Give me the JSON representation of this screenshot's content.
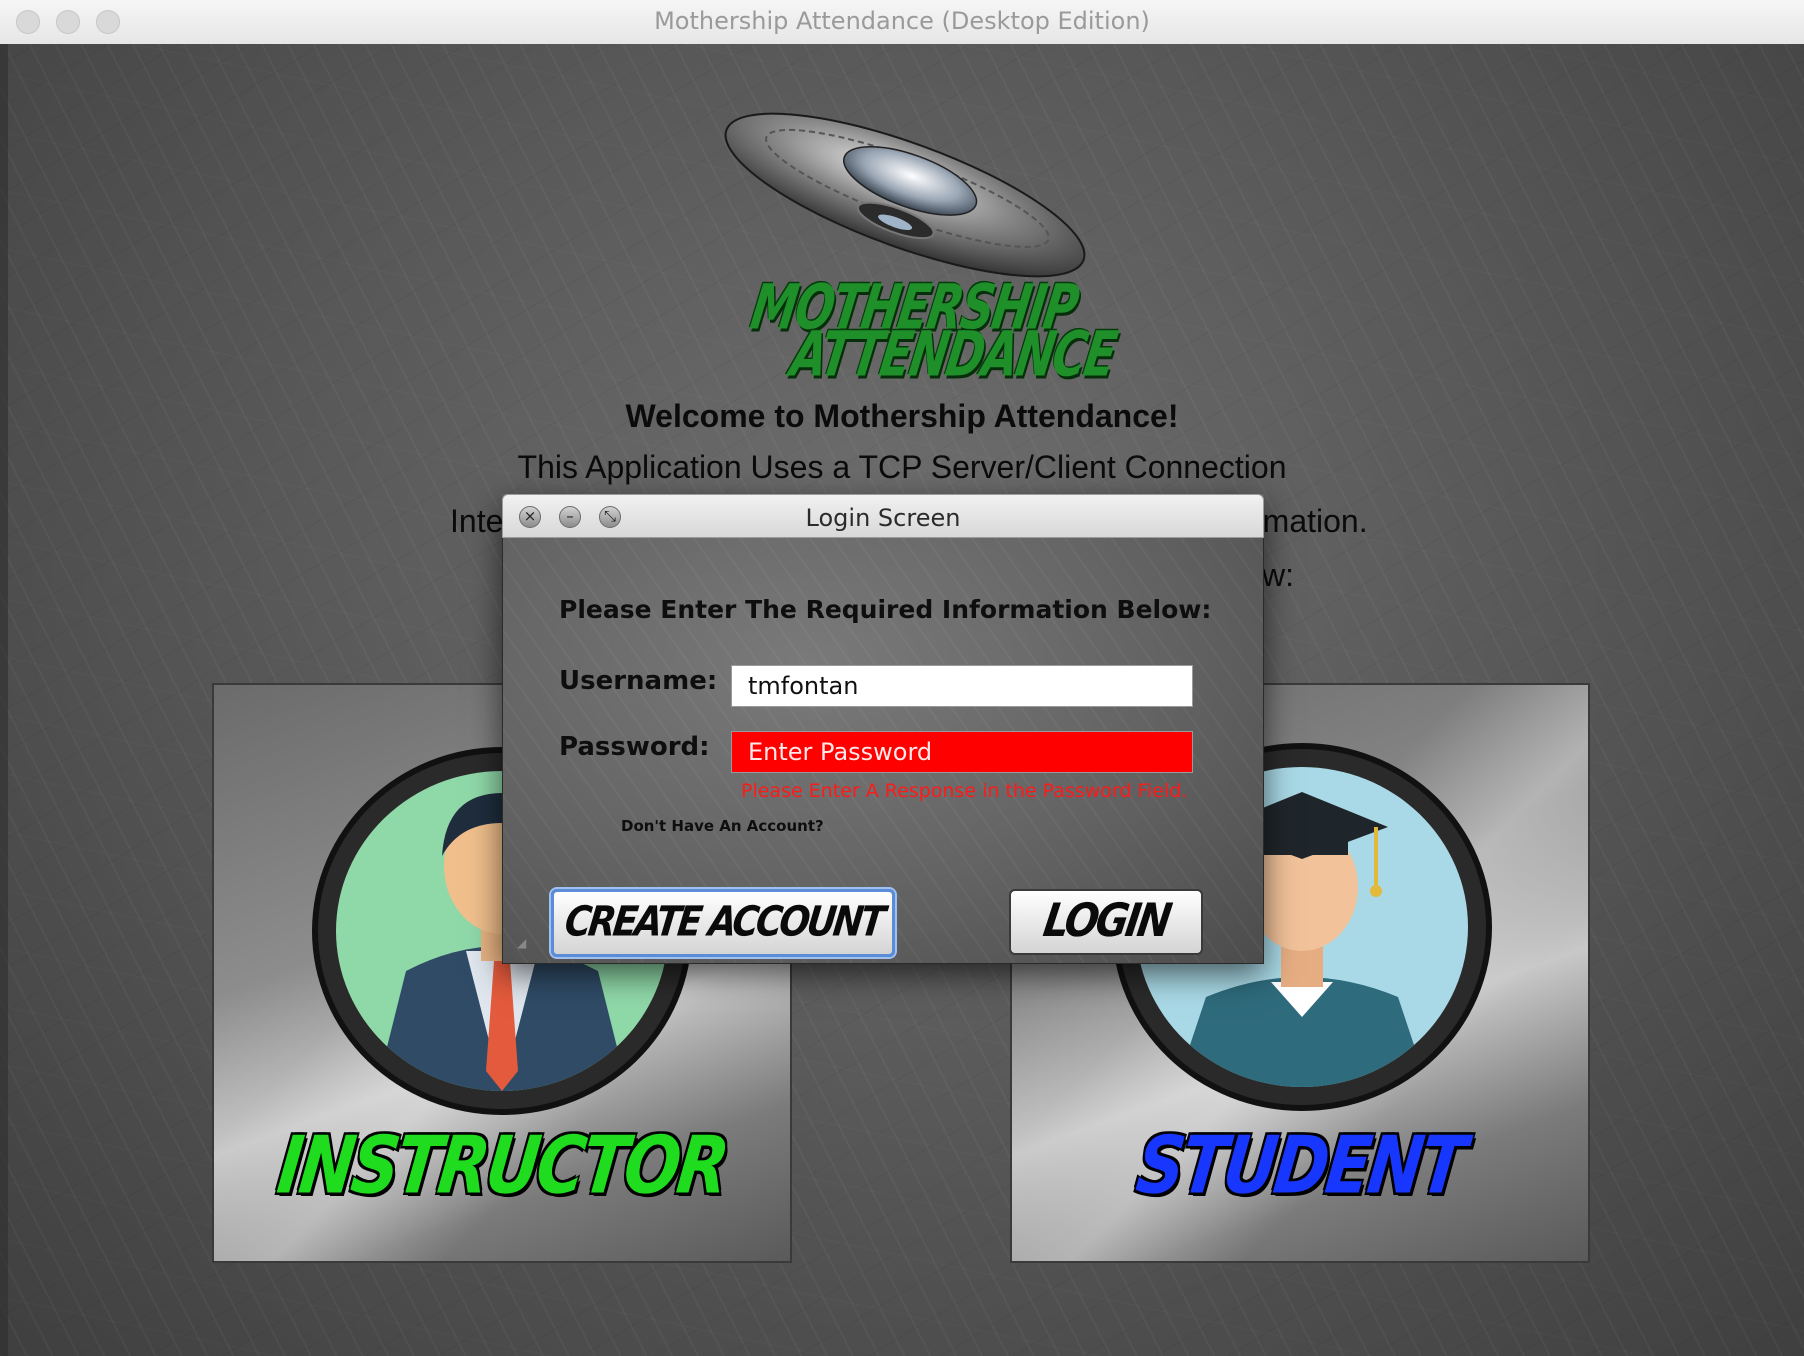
{
  "window": {
    "title": "Mothership Attendance (Desktop Edition)"
  },
  "logo": {
    "line1": "MOTHERSHIP",
    "line2": "ATTENDANCE"
  },
  "welcome": {
    "heading": "Welcome to Mothership Attendance!",
    "line2": "This Application Uses a TCP Server/Client Connection",
    "line3_left": "Inte",
    "line3_right": "rmation.",
    "line4_right": "w:"
  },
  "roles": {
    "instructor_label": "INSTRUCTOR",
    "student_label": "STUDENT"
  },
  "dialog": {
    "title": "Login Screen",
    "prompt": "Please Enter The Required Information Below:",
    "username_label": "Username:",
    "username_value": "tmfontan",
    "password_label": "Password:",
    "password_placeholder": "Enter Password",
    "error_text": "Please Enter A Response in the Password Field.",
    "no_account_text": "Don't Have An Account?",
    "create_account_label": "CREATE ACCOUNT",
    "login_label": "LOGIN",
    "btn_close": "×",
    "btn_min": "–",
    "btn_zoom": "⤡"
  },
  "colors": {
    "instructor_green": "#1fdc1f",
    "student_blue": "#1737ff",
    "error_red": "#ff0000",
    "logo_green": "#1f8f2a"
  }
}
